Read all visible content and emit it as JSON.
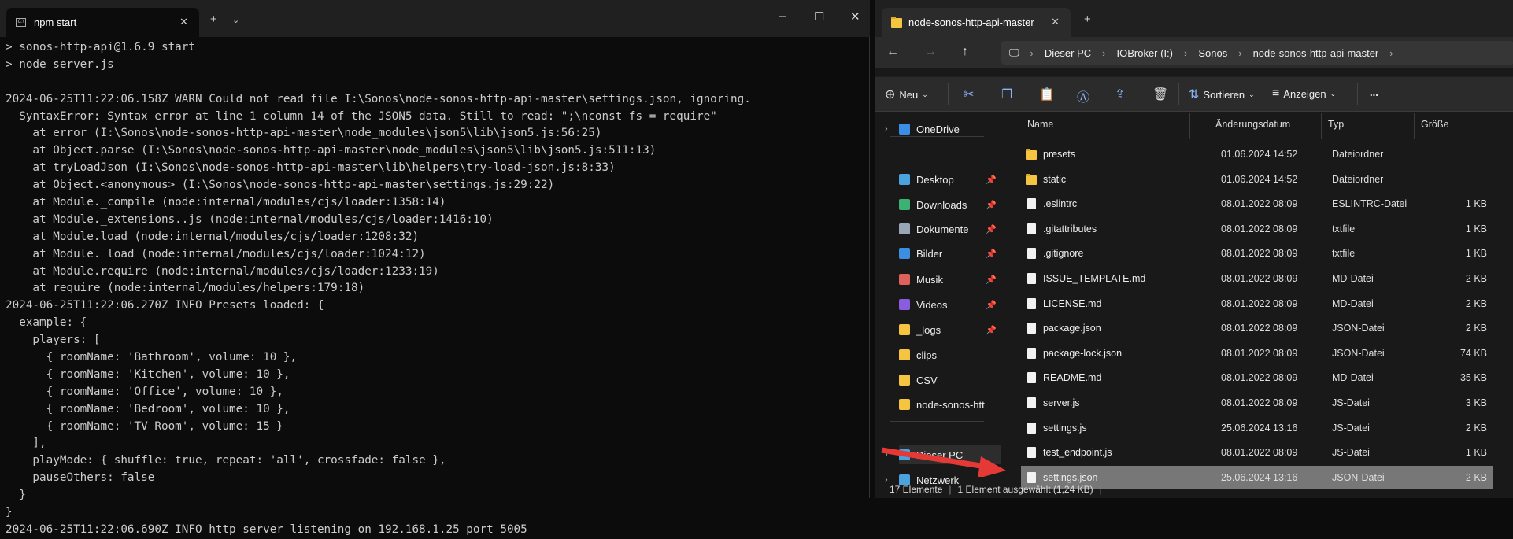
{
  "terminal": {
    "tab_title": "npm start",
    "lines": [
      "> sonos-http-api@1.6.9 start",
      "> node server.js",
      "",
      "2024-06-25T11:22:06.158Z WARN Could not read file I:\\Sonos\\node-sonos-http-api-master\\settings.json, ignoring.",
      "  SyntaxError: Syntax error at line 1 column 14 of the JSON5 data. Still to read: \";\\nconst fs = require\"",
      "    at error (I:\\Sonos\\node-sonos-http-api-master\\node_modules\\json5\\lib\\json5.js:56:25)",
      "    at Object.parse (I:\\Sonos\\node-sonos-http-api-master\\node_modules\\json5\\lib\\json5.js:511:13)",
      "    at tryLoadJson (I:\\Sonos\\node-sonos-http-api-master\\lib\\helpers\\try-load-json.js:8:33)",
      "    at Object.<anonymous> (I:\\Sonos\\node-sonos-http-api-master\\settings.js:29:22)",
      "    at Module._compile (node:internal/modules/cjs/loader:1358:14)",
      "    at Module._extensions..js (node:internal/modules/cjs/loader:1416:10)",
      "    at Module.load (node:internal/modules/cjs/loader:1208:32)",
      "    at Module._load (node:internal/modules/cjs/loader:1024:12)",
      "    at Module.require (node:internal/modules/cjs/loader:1233:19)",
      "    at require (node:internal/modules/helpers:179:18)",
      "2024-06-25T11:22:06.270Z INFO Presets loaded: {",
      "  example: {",
      "    players: [",
      "      { roomName: 'Bathroom', volume: 10 },",
      "      { roomName: 'Kitchen', volume: 10 },",
      "      { roomName: 'Office', volume: 10 },",
      "      { roomName: 'Bedroom', volume: 10 },",
      "      { roomName: 'TV Room', volume: 15 }",
      "    ],",
      "    playMode: { shuffle: true, repeat: 'all', crossfade: false },",
      "    pauseOthers: false",
      "  }",
      "}",
      "2024-06-25T11:22:06.690Z INFO http server listening on 192.168.1.25 port 5005"
    ]
  },
  "explorer": {
    "tab_title": "node-sonos-http-api-master",
    "breadcrumb": [
      "Dieser PC",
      "IOBroker (I:)",
      "Sonos",
      "node-sonos-http-api-master"
    ],
    "toolbar": {
      "new": "Neu",
      "sort": "Sortieren",
      "view": "Anzeigen",
      "more": "..."
    },
    "sidebar": [
      {
        "label": "OneDrive",
        "color": "#3a8ee6",
        "expand": true
      },
      {
        "label": "Desktop",
        "color": "#4aa3e0",
        "pinned": true
      },
      {
        "label": "Downloads",
        "color": "#3bb273",
        "pinned": true
      },
      {
        "label": "Dokumente",
        "color": "#9aa6b8",
        "pinned": true
      },
      {
        "label": "Bilder",
        "color": "#3c8fe0",
        "pinned": true
      },
      {
        "label": "Musik",
        "color": "#e0605a",
        "pinned": true
      },
      {
        "label": "Videos",
        "color": "#8a5ce0",
        "pinned": true
      },
      {
        "label": "_logs",
        "color": "#f5c542",
        "pinned": true
      },
      {
        "label": "clips",
        "color": "#f5c542"
      },
      {
        "label": "CSV",
        "color": "#f5c542"
      },
      {
        "label": "node-sonos-htt",
        "color": "#f5c542"
      },
      {
        "label": "Dieser PC",
        "color": "#4aa3e0",
        "expand": true
      },
      {
        "label": "Netzwerk",
        "color": "#4aa3e0",
        "expand": true
      }
    ],
    "columns": [
      "Name",
      "Änderungsdatum",
      "Typ",
      "Größe"
    ],
    "files": [
      {
        "name": "presets",
        "date": "01.06.2024 14:52",
        "type": "Dateiordner",
        "size": "",
        "folder": true
      },
      {
        "name": "static",
        "date": "01.06.2024 14:52",
        "type": "Dateiordner",
        "size": "",
        "folder": true
      },
      {
        "name": ".eslintrc",
        "date": "08.01.2022 08:09",
        "type": "ESLINTRC-Datei",
        "size": "1 KB"
      },
      {
        "name": ".gitattributes",
        "date": "08.01.2022 08:09",
        "type": "txtfile",
        "size": "1 KB"
      },
      {
        "name": ".gitignore",
        "date": "08.01.2022 08:09",
        "type": "txtfile",
        "size": "1 KB"
      },
      {
        "name": "ISSUE_TEMPLATE.md",
        "date": "08.01.2022 08:09",
        "type": "MD-Datei",
        "size": "2 KB"
      },
      {
        "name": "LICENSE.md",
        "date": "08.01.2022 08:09",
        "type": "MD-Datei",
        "size": "2 KB"
      },
      {
        "name": "package.json",
        "date": "08.01.2022 08:09",
        "type": "JSON-Datei",
        "size": "2 KB"
      },
      {
        "name": "package-lock.json",
        "date": "08.01.2022 08:09",
        "type": "JSON-Datei",
        "size": "74 KB"
      },
      {
        "name": "README.md",
        "date": "08.01.2022 08:09",
        "type": "MD-Datei",
        "size": "35 KB"
      },
      {
        "name": "server.js",
        "date": "08.01.2022 08:09",
        "type": "JS-Datei",
        "size": "3 KB"
      },
      {
        "name": "settings.js",
        "date": "25.06.2024 13:16",
        "type": "JS-Datei",
        "size": "2 KB"
      },
      {
        "name": "test_endpoint.js",
        "date": "08.01.2022 08:09",
        "type": "JS-Datei",
        "size": "1 KB"
      },
      {
        "name": "settings.json",
        "date": "25.06.2024 13:16",
        "type": "JSON-Datei",
        "size": "2 KB",
        "selected": true
      }
    ],
    "status": {
      "count": "17 Elemente",
      "selection": "1 Element ausgewählt (1,24 KB)"
    }
  }
}
